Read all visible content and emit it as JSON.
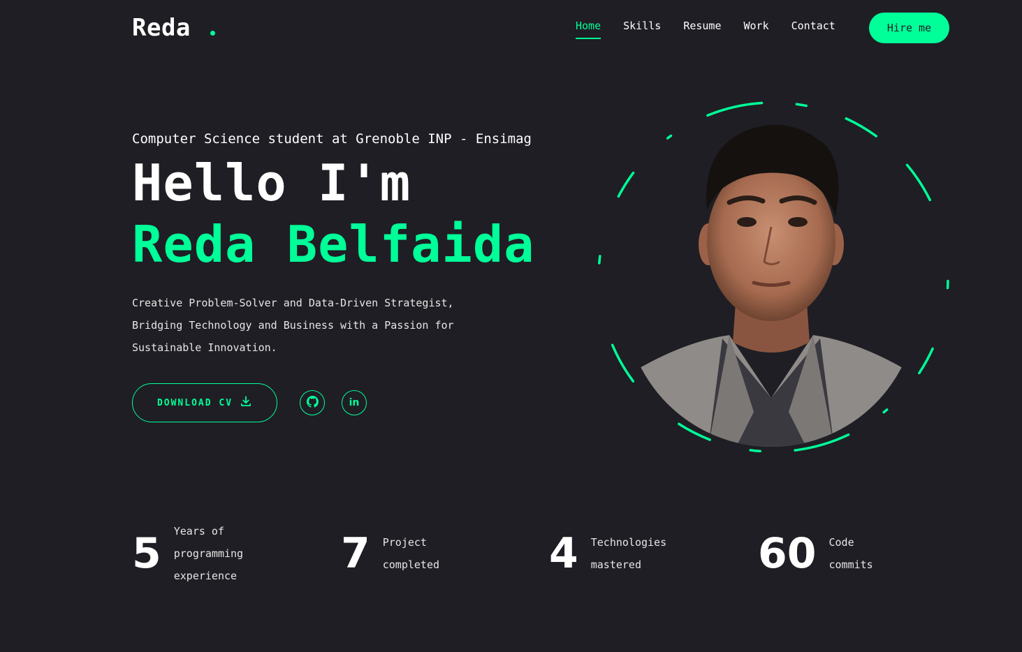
{
  "header": {
    "logo": "Reda",
    "nav": [
      {
        "label": "Home",
        "active": true
      },
      {
        "label": "Skills",
        "active": false
      },
      {
        "label": "Resume",
        "active": false
      },
      {
        "label": "Work",
        "active": false
      },
      {
        "label": "Contact",
        "active": false
      }
    ],
    "hire_label": "Hire me"
  },
  "hero": {
    "subtitle": "Computer Science student at Grenoble INP - Ensimag",
    "greeting": "Hello I'm",
    "name": "Reda Belfaida",
    "description_lines": [
      "Creative Problem-Solver and Data-Driven Strategist,",
      "Bridging Technology and Business with a Passion for",
      "Sustainable Innovation."
    ],
    "download_label": "DOWNLOAD CV"
  },
  "social": [
    {
      "icon": "github-icon"
    },
    {
      "icon": "linkedin-icon",
      "text": "in"
    }
  ],
  "stats": [
    {
      "value": "5",
      "label_lines": [
        "Years of",
        "programming",
        "experience"
      ]
    },
    {
      "value": "7",
      "label_lines": [
        "Project",
        "completed"
      ]
    },
    {
      "value": "4",
      "label_lines": [
        "Technologies",
        "mastered"
      ]
    },
    {
      "value": "60",
      "label_lines": [
        "Code",
        "commits"
      ]
    }
  ],
  "colors": {
    "accent": "#00ff99",
    "background": "#1f1e24",
    "text": "#ffffff"
  }
}
